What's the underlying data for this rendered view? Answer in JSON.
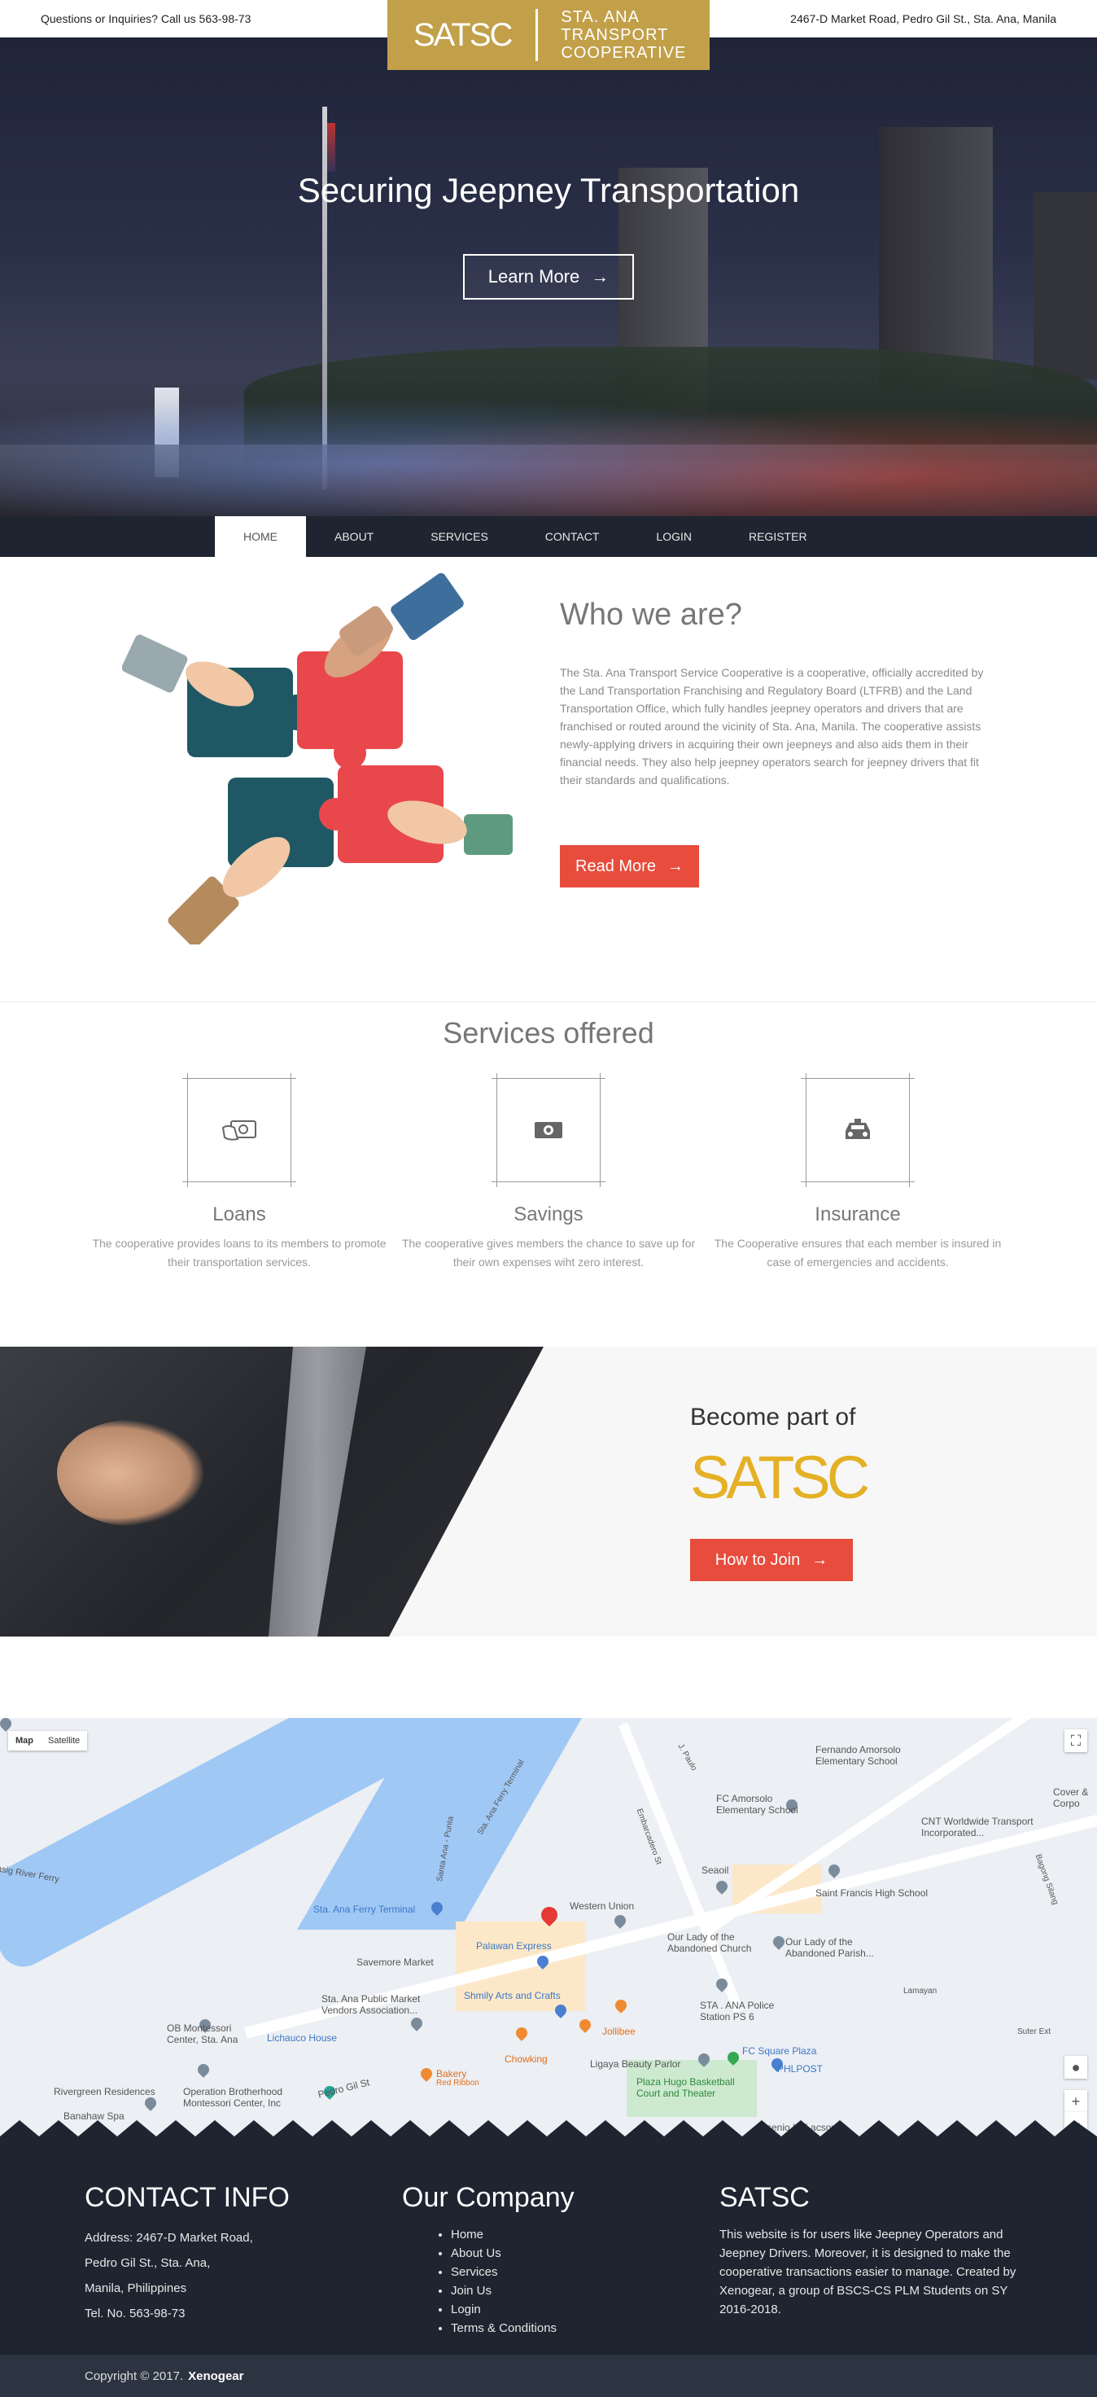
{
  "topbar": {
    "inquiry": "Questions or Inquiries? Call us 563-98-73",
    "address": "2467-D Market Road, Pedro Gil St., Sta. Ana, Manila"
  },
  "logo": {
    "mark": "SATSC",
    "line1": "STA. ANA",
    "line2": "TRANSPORT",
    "line3": "COOPERATIVE"
  },
  "hero": {
    "title": "Securing Jeepney Transportation",
    "button": "Learn More",
    "arrow": "→"
  },
  "nav": {
    "items": [
      "HOME",
      "ABOUT",
      "SERVICES",
      "CONTACT",
      "LOGIN",
      "REGISTER"
    ],
    "active": "HOME"
  },
  "about": {
    "title": "Who we are?",
    "text": "The Sta. Ana Transport Service Cooperative is a cooperative, officially accredited by the Land Transportation Franchising and Regulatory Board (LTFRB) and the Land Transportation Office, which fully handles jeepney operators and drivers that are franchised or routed around the vicinity of Sta. Ana, Manila. The cooperative assists newly-applying drivers in acquiring their own jeepneys and also aids them in their financial needs. They also help jeepney operators search for jeepney drivers that fit their standards and qualifications.",
    "button": "Read More"
  },
  "services": {
    "title": "Services offered",
    "items": [
      {
        "name": "Loans",
        "desc": "The cooperative provides loans to its members to promote their transportation services.",
        "icon": "money-hand-icon"
      },
      {
        "name": "Savings",
        "desc": "The cooperative gives members the chance to save up for their own expenses wiht zero interest.",
        "icon": "money-icon"
      },
      {
        "name": "Insurance",
        "desc": "The Cooperative ensures that each member is insured in case of emergencies and accidents.",
        "icon": "taxi-icon"
      }
    ]
  },
  "join": {
    "subtitle": "Become part of",
    "logo": "SATSC",
    "button": "How to Join"
  },
  "map": {
    "type_map": "Map",
    "type_satellite": "Satellite",
    "labels": [
      "Sta. Ana Ferry Terminal",
      "Western Union",
      "Palawan Express",
      "Savemore Market",
      "Sta. Ana Public Market Vendors Association...",
      "Shmily Arts and Crafts",
      "Jollibee",
      "Chowking",
      "OB Montessori Center, Sta. Ana",
      "Lichauco House",
      "Bakery",
      "Red Ribbon",
      "Rivergreen Residences",
      "Operation Brotherhood Montessori Center, Inc",
      "Banahaw Spa",
      "Pedro Gil St",
      "Ligaya Beauty Parlor",
      "Plaza Hugo Basketball Court and Theater",
      "FC Square Plaza",
      "PHLPOST",
      "STA . ANA Police Station PS 6",
      "Our Lady of the Abandoned Church",
      "Our Lady of the Abandoned Parish...",
      "Saint Francis High School",
      "Seaoil",
      "CNT Worldwide Transport Incorporated...",
      "FC Amorsolo Elementary School",
      "Fernando Amorsolo Elementary School",
      "Cover & Corpo",
      "Lamayan",
      "Suter Ext",
      "Embarcadero St",
      "Santa Ana - Punta",
      "Sta. Ana Ferry Terminal",
      "Pasig River Ferry",
      "J. Paulo",
      "Bagong Silang",
      "Arsenio H. Lacson"
    ]
  },
  "footer": {
    "contact": {
      "title": "CONTACT INFO",
      "lines": [
        "Address: 2467-D Market Road,",
        "Pedro Gil St., Sta. Ana,",
        "Manila, Philippines",
        "Tel. No. 563-98-73"
      ]
    },
    "company": {
      "title": "Our Company",
      "links": [
        "Home",
        "About Us",
        "Services",
        "Join Us",
        "Login",
        "Terms & Conditions"
      ]
    },
    "satsc": {
      "title": "SATSC",
      "text": "This website is for users like Jeepney Operators and Jeepney Drivers. Moreover, it is designed to make the cooperative transactions easier to manage. Created by Xenogear, a group of BSCS-CS PLM Students on SY 2016-2018."
    },
    "copyright": "Copyright © 2017.",
    "copyright_brand": "Xenogear"
  },
  "colors": {
    "gold": "#c2a04a",
    "navy": "#1e2430",
    "red": "#e74c3c",
    "yellow": "#e4b126"
  }
}
